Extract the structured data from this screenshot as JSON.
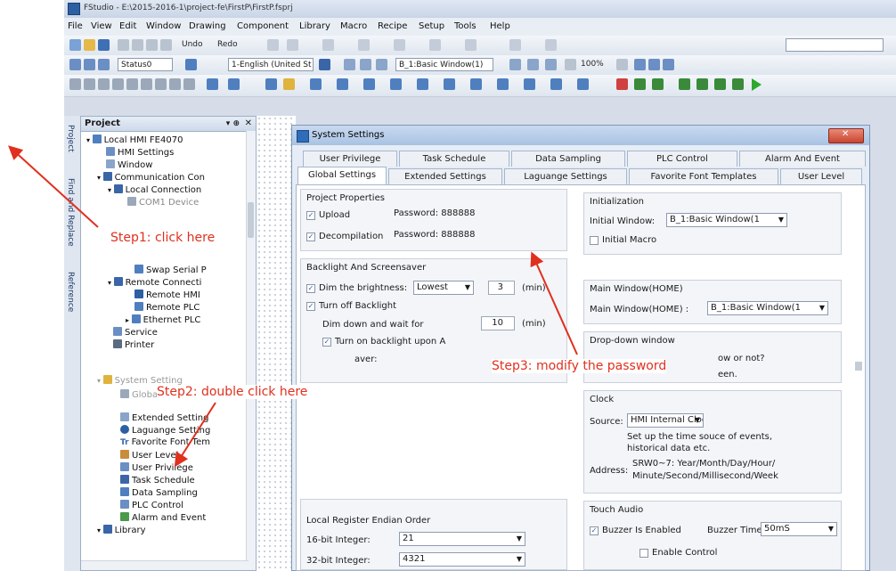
{
  "window": {
    "title": "FStudio - E:\\2015-2016-1\\project-fe\\FirstP\\FirstP.fsprj"
  },
  "menu": [
    "File",
    "View",
    "Edit",
    "Window",
    "Drawing",
    "Component",
    "Library",
    "Macro",
    "Recipe",
    "Setup",
    "Tools",
    "Help"
  ],
  "toolbar": {
    "undo": "Undo",
    "redo": "Redo",
    "status": "Status0",
    "language": "1-English (United St",
    "window_select": "B_1:Basic Window(1)",
    "zoom": "100%"
  },
  "sidetabs": [
    "Project",
    "Find and Replace",
    "Reference"
  ],
  "project": {
    "title": "Project",
    "items": [
      "Local HMI FE4070",
      "HMI Settings",
      "Window",
      "Communication Con",
      "Local Connection",
      "COM1 Device",
      "Swap Serial P",
      "Remote Connecti",
      "Remote HMI",
      "Remote PLC",
      "Ethernet PLC",
      "Service",
      "Printer",
      "System Setting",
      "Global Settings",
      "Extended Setting",
      "Laguange Setting",
      "Favorite Font Tem",
      "User Level",
      "User Privilege",
      "Task Schedule",
      "Data Sampling",
      "PLC Control",
      "Alarm and Event",
      "Library"
    ]
  },
  "dialog": {
    "title": "System Settings",
    "tabs_row1": [
      "User Privilege",
      "Task Schedule",
      "Data Sampling",
      "PLC Control",
      "Alarm And Event"
    ],
    "tabs_row2": [
      "Global Settings",
      "Extended Settings",
      "Laguange Settings",
      "Favorite Font Templates",
      "User Level"
    ],
    "project_properties": {
      "title": "Project Properties",
      "upload_label": "Upload",
      "upload_password": "Password: 888888",
      "decompile_label": "Decompilation",
      "decompile_password": "Password: 888888"
    },
    "backlight": {
      "title": "Backlight And Screensaver",
      "dim_label": "Dim the brightness:",
      "dim_value": "Lowest",
      "dim_minutes": "3",
      "unit": "(min)",
      "turnoff_label": "Turn off Backlight",
      "wait_label": "Dim down and wait for",
      "wait_minutes": "10",
      "turn_on_label": "Turn on backlight upon A",
      "saver_label": "aver:"
    },
    "initialization": {
      "title": "Initialization",
      "window_label": "Initial Window:",
      "window_value": "B_1:Basic Window(1",
      "macro_label": "Initial Macro"
    },
    "main_window": {
      "title": "Main Window(HOME)",
      "label": "Main Window(HOME) :",
      "value": "B_1:Basic Window(1"
    },
    "dropdown_window": {
      "title": "Drop-down window",
      "line1": "ow or not?",
      "line2": "een."
    },
    "clock": {
      "title": "Clock",
      "source_label": "Source:",
      "source_value": "HMI Internal Clock",
      "desc1": "Set up the time souce of events,",
      "desc2": "historical data etc.",
      "address_label": "Address:",
      "address1": "SRW0~7: Year/Month/Day/Hour/",
      "address2": "Minute/Second/Millisecond/Week"
    },
    "endian": {
      "title": "Local Register Endian Order",
      "int16_label": "16-bit Integer:",
      "int16_value": "21",
      "int32_label": "32-bit Integer:",
      "int32_value": "4321"
    },
    "touch_audio": {
      "title": "Touch Audio",
      "buzzer_label": "Buzzer Is Enabled",
      "buzzer_time_label": "Buzzer Time:",
      "buzzer_time_value": "50mS",
      "control_label": "Enable Control"
    }
  },
  "annotations": {
    "step1": "Step1: click here",
    "step2": "Step2: double click here",
    "step3": "Step3: modify the password",
    "color": "#e0301e"
  }
}
